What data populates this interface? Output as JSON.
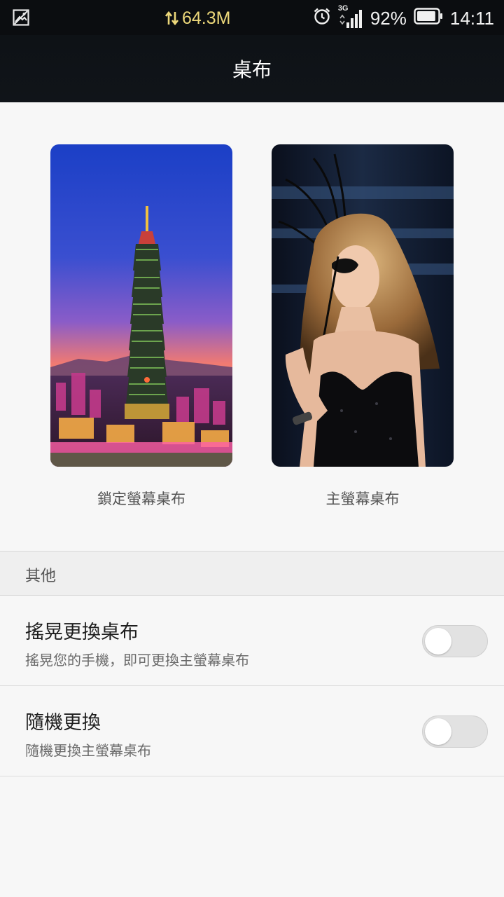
{
  "status_bar": {
    "data_speed": "64.3M",
    "network": "3G",
    "battery_percent": "92%",
    "battery_level": 0.92,
    "time": "14:11",
    "icons": [
      "image-notification-icon",
      "data-transfer-icon",
      "alarm-icon",
      "signal-icon",
      "battery-icon"
    ]
  },
  "header": {
    "title": "桌布"
  },
  "wallpapers": {
    "lock_screen_label": "鎖定螢幕桌布",
    "home_screen_label": "主螢幕桌布"
  },
  "other_section": {
    "header": "其他",
    "shake": {
      "title": "搖晃更換桌布",
      "subtitle": "搖晃您的手機，即可更換主螢幕桌布",
      "enabled": false
    },
    "random": {
      "title": "隨機更換",
      "subtitle": "隨機更換主螢幕桌布",
      "enabled": false
    }
  },
  "colors": {
    "toggle_off": "#e2e2e2",
    "data_speed": "#ecd77a",
    "background": "#f7f7f7"
  }
}
